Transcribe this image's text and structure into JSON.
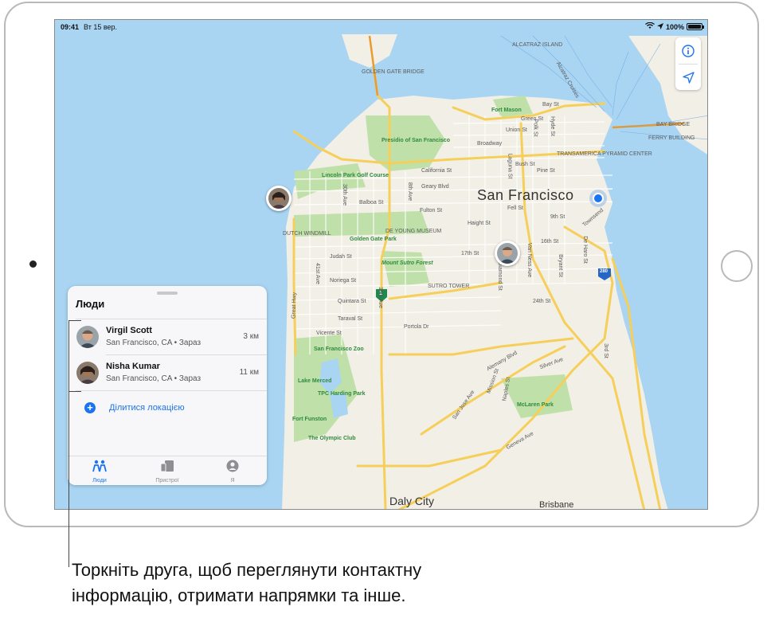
{
  "status_bar": {
    "time": "09:41",
    "date": "Вт 15 вер.",
    "battery": "100%"
  },
  "map": {
    "labels": {
      "alcatraz": "ALCATRAZ ISLAND",
      "golden_gate": "GOLDEN GATE BRIDGE",
      "presidio": "Presidio of San Francisco",
      "fort_mason": "Fort Mason",
      "lincoln_park": "Lincoln Park Golf Course",
      "golden_gate_park": "Golden Gate Park",
      "de_young": "DE YOUNG MUSEUM",
      "dutch_windmill": "DUTCH WINDMILL",
      "mount_sutro": "Mount Sutro Forest",
      "sutro_tower": "SUTRO TOWER",
      "transamerica": "TRANSAMERICA PYRAMID CENTER",
      "ferry": "FERRY BUILDING",
      "bay_bridge": "BAY BRIDGE",
      "san_francisco": "San Francisco",
      "sf_zoo": "San Francisco Zoo",
      "lake_merced": "Lake Merced",
      "tpc_harding": "TPC Harding Park",
      "fort_funston": "Fort Funston",
      "olympic_club": "The Olympic Club",
      "mclaren": "McLaren Park",
      "daly_city": "Daly City",
      "brisbane": "Brisbane",
      "bay_st": "Bay St",
      "union_st": "Union St",
      "broadway": "Broadway",
      "california_st": "California St",
      "geary": "Geary Blvd",
      "balboa": "Balboa St",
      "fulton": "Fulton St",
      "fell": "Fell St",
      "haight": "Haight St",
      "judah": "Judah St",
      "noriega": "Noriega St",
      "quintara": "Quintara St",
      "taraval": "Taraval St",
      "vicente": "Vicente St",
      "portola": "Portola Dr",
      "st17": "17th St",
      "st16": "16th St",
      "st24": "24th St",
      "alemany": "Alemany Blvd",
      "silver": "Silver Ave",
      "mission": "Mission St",
      "great_hwy": "Great Hwy",
      "ave41": "41st Ave",
      "ave30": "30th Ave",
      "ave8": "8th Ave",
      "ave19": "19th Ave",
      "diamond": "Diamond St",
      "van_ness": "Van Ness Ave",
      "bryant": "Bryant St",
      "de_haro": "De Haro St",
      "third": "3rd St",
      "hyde": "Hyde St",
      "polk": "Polk St",
      "laguna": "Laguna St",
      "bush": "Bush St",
      "pine": "Pine St",
      "green": "Green St",
      "san_jose": "San Jose Ave",
      "naples": "Naples St",
      "geneva": "Geneva Ave",
      "alcatraz_cruises": "Alcatraz Cruises",
      "townsend": "Townsend",
      "ninth_st": "9th St",
      "hwy1": "1",
      "hwy280": "280"
    }
  },
  "panel": {
    "title": "Люди",
    "people": [
      {
        "name": "Virgil Scott",
        "location": "San Francisco, CA • Зараз",
        "distance": "3 км"
      },
      {
        "name": "Nisha Kumar",
        "location": "San Francisco, CA • Зараз",
        "distance": "11 км"
      }
    ],
    "share_label": "Ділитися локацією",
    "tabs": [
      {
        "label": "Люди",
        "icon": "people-icon",
        "active": true
      },
      {
        "label": "Пристрої",
        "icon": "devices-icon",
        "active": false
      },
      {
        "label": "Я",
        "icon": "me-icon",
        "active": false
      }
    ]
  },
  "callout": {
    "text": "Торкніть друга, щоб переглянути контактну інформацію, отримати напрямки та інше."
  },
  "colors": {
    "accent": "#1a73f0",
    "water": "#a9d5f3",
    "land": "#f2efe6",
    "park": "#bfe1a9",
    "road": "#f6cf5a"
  }
}
